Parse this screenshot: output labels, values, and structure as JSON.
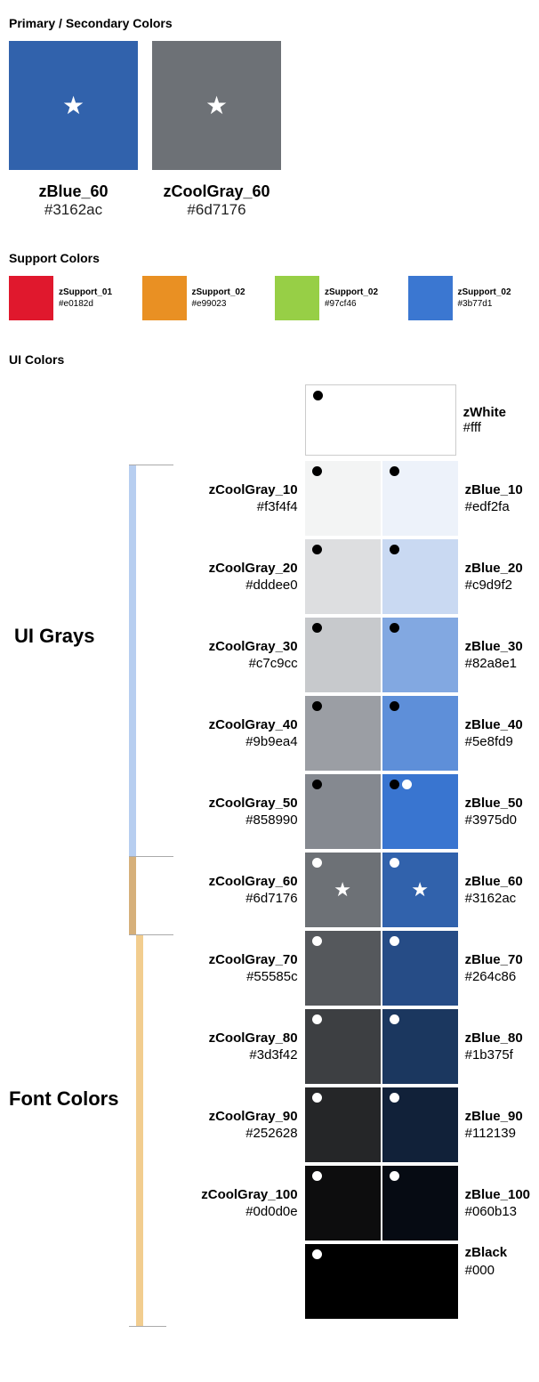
{
  "sections": {
    "primary_title": "Primary / Secondary Colors",
    "support_title": "Support Colors",
    "ui_title": "UI Colors"
  },
  "primary": [
    {
      "name": "zBlue_60",
      "hex": "#3162ac"
    },
    {
      "name": "zCoolGray_60",
      "hex": "#6d7176"
    }
  ],
  "support": [
    {
      "name": "zSupport_01",
      "hex": "#e0182d"
    },
    {
      "name": "zSupport_02",
      "hex": "#e99023"
    },
    {
      "name": "zSupport_02",
      "hex": "#97cf46"
    },
    {
      "name": "zSupport_02",
      "hex": "#3b77d1"
    }
  ],
  "scale_labels": {
    "ui_grays": "UI Grays",
    "font_colors": "Font Colors"
  },
  "white": {
    "name": "zWhite",
    "hex": "#fff"
  },
  "black": {
    "name": "zBlack",
    "hex": "#000"
  },
  "grays": [
    {
      "name": "zCoolGray_10",
      "hex": "#f3f4f4"
    },
    {
      "name": "zCoolGray_20",
      "hex": "#dddee0"
    },
    {
      "name": "zCoolGray_30",
      "hex": "#c7c9cc"
    },
    {
      "name": "zCoolGray_40",
      "hex": "#9b9ea4"
    },
    {
      "name": "zCoolGray_50",
      "hex": "#858990"
    },
    {
      "name": "zCoolGray_60",
      "hex": "#6d7176"
    },
    {
      "name": "zCoolGray_70",
      "hex": "#55585c"
    },
    {
      "name": "zCoolGray_80",
      "hex": "#3d3f42"
    },
    {
      "name": "zCoolGray_90",
      "hex": "#252628"
    },
    {
      "name": "zCoolGray_100",
      "hex": "#0d0d0e"
    }
  ],
  "blues": [
    {
      "name": "zBlue_10",
      "hex": "#edf2fa"
    },
    {
      "name": "zBlue_20",
      "hex": "#c9d9f2"
    },
    {
      "name": "zBlue_30",
      "hex": "#82a8e1"
    },
    {
      "name": "zBlue_40",
      "hex": "#5e8fd9"
    },
    {
      "name": "zBlue_50",
      "hex": "#3975d0"
    },
    {
      "name": "zBlue_60",
      "hex": "#3162ac"
    },
    {
      "name": "zBlue_70",
      "hex": "#264c86"
    },
    {
      "name": "zBlue_80",
      "hex": "#1b375f"
    },
    {
      "name": "zBlue_90",
      "hex": "#112139"
    },
    {
      "name": "zBlue_100",
      "hex": "#060b13"
    }
  ],
  "bar_colors": {
    "ui_top": "#b7cef0",
    "mid": "#d6b07a",
    "font": "#f2cd8f"
  }
}
